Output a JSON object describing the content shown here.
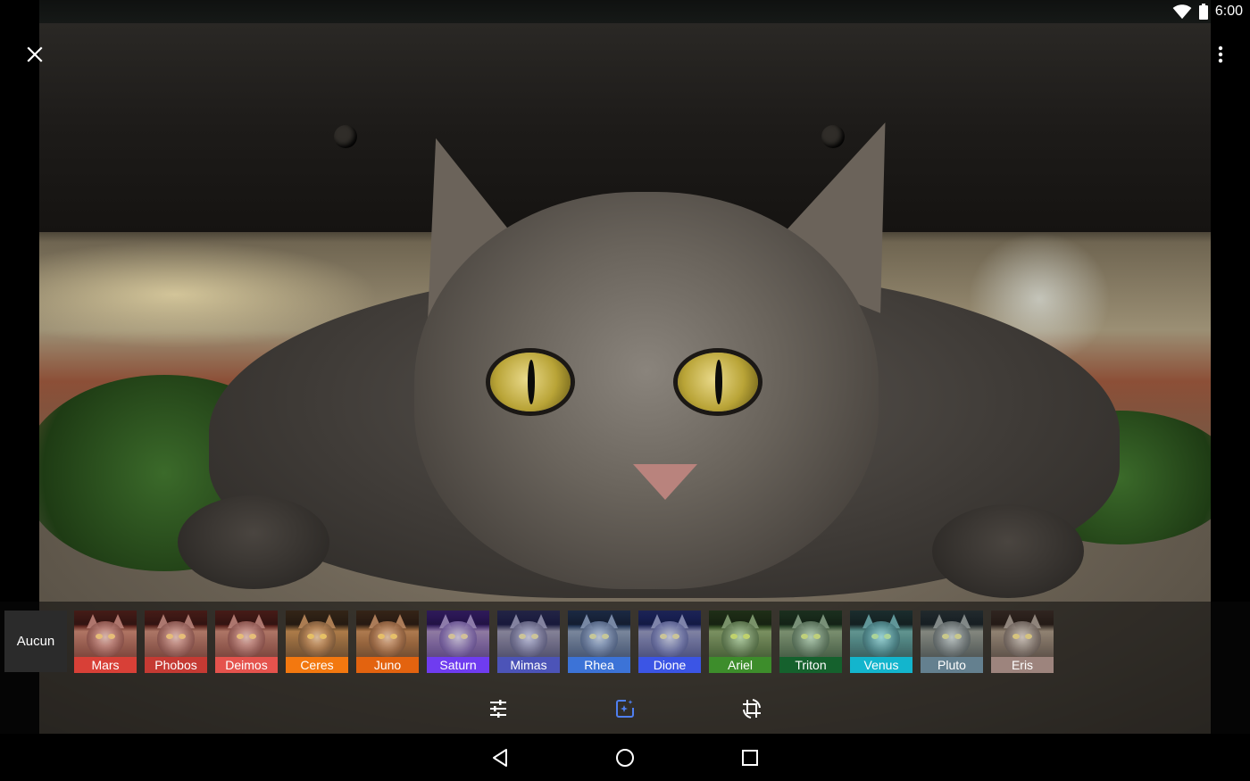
{
  "status_bar": {
    "time": "6:00",
    "icons": [
      "wifi-icon",
      "battery-icon"
    ]
  },
  "toolbar": {
    "close_icon": "close-icon",
    "more_icon": "more-vert-icon"
  },
  "filters": {
    "none_label": "Aucun",
    "items": [
      {
        "label": "Mars",
        "color": "#d84037"
      },
      {
        "label": "Phobos",
        "color": "#c53a33"
      },
      {
        "label": "Deimos",
        "color": "#e5534d"
      },
      {
        "label": "Ceres",
        "color": "#f3780f"
      },
      {
        "label": "Juno",
        "color": "#e3630f"
      },
      {
        "label": "Saturn",
        "color": "#6f3cf0"
      },
      {
        "label": "Mimas",
        "color": "#4c54b8"
      },
      {
        "label": "Rhea",
        "color": "#3c73d7"
      },
      {
        "label": "Dione",
        "color": "#3b55e5"
      },
      {
        "label": "Ariel",
        "color": "#3d8d2b"
      },
      {
        "label": "Triton",
        "color": "#15612d"
      },
      {
        "label": "Venus",
        "color": "#13b5cd"
      },
      {
        "label": "Pluto",
        "color": "#64808f"
      },
      {
        "label": "Eris",
        "color": "#9d847d"
      }
    ]
  },
  "edit_tools": {
    "active_color": "#4f7ff0",
    "items": [
      {
        "name": "adjustments-icon",
        "active": false
      },
      {
        "name": "auto-fix-icon",
        "active": true
      },
      {
        "name": "crop-rotate-icon",
        "active": false
      }
    ]
  },
  "nav_bar": {
    "icons": [
      "back-icon",
      "home-icon",
      "recents-icon"
    ]
  }
}
